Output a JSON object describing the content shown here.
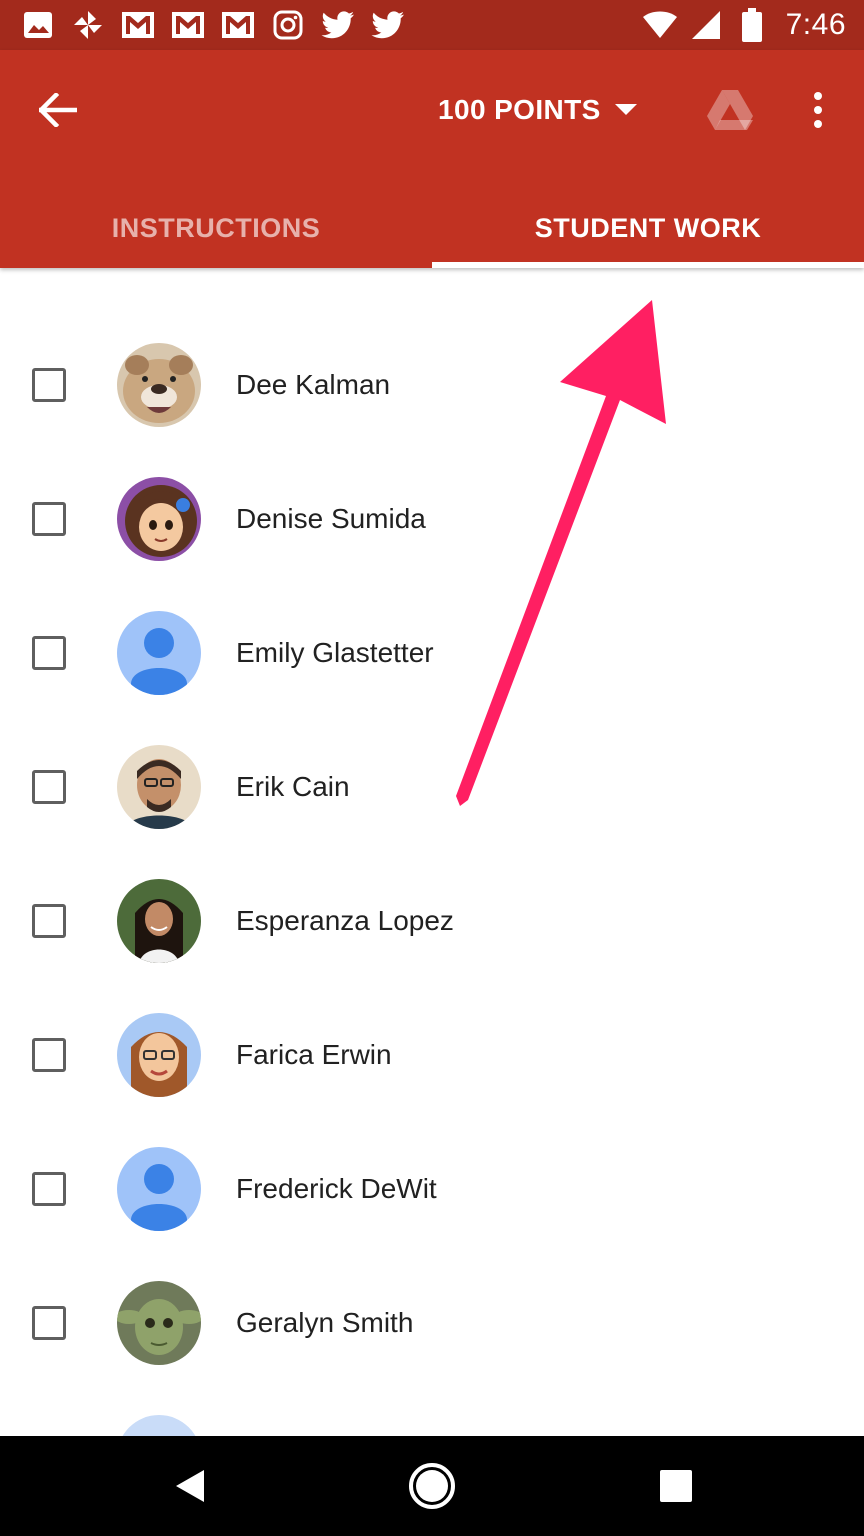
{
  "status_bar": {
    "time": "7:46",
    "left_icons": [
      "image-icon",
      "pinwheel-icon",
      "gmail-icon",
      "gmail-icon",
      "gmail-icon",
      "instagram-icon",
      "twitter-icon",
      "twitter-icon"
    ],
    "right_icons": [
      "wifi-icon",
      "signal-icon",
      "battery-icon"
    ]
  },
  "app_bar": {
    "points_label": "100 POINTS",
    "tabs": [
      {
        "label": "INSTRUCTIONS",
        "selected": false
      },
      {
        "label": "STUDENT WORK",
        "selected": true
      }
    ],
    "colors": {
      "status_bar": "#A32A1C",
      "app_bar": "#C13222"
    }
  },
  "students": [
    {
      "name": "Dee Kalman",
      "avatar": "bulldog-photo",
      "checked": false
    },
    {
      "name": "Denise Sumida",
      "avatar": "cartoon-girl",
      "checked": false
    },
    {
      "name": "Emily Glastetter",
      "avatar": "default-person-icon",
      "checked": false
    },
    {
      "name": "Erik Cain",
      "avatar": "man-photo",
      "checked": false
    },
    {
      "name": "Esperanza Lopez",
      "avatar": "woman-photo",
      "checked": false
    },
    {
      "name": "Farica Erwin",
      "avatar": "bitmoji-woman",
      "checked": false
    },
    {
      "name": "Frederick DeWit",
      "avatar": "default-person-icon",
      "checked": false
    },
    {
      "name": "Geralyn Smith",
      "avatar": "yoda-photo",
      "checked": false
    }
  ],
  "annotation": {
    "arrow_color": "#FF1F62"
  },
  "nav_bar": {
    "buttons": [
      "back-triangle-icon",
      "home-circle-icon",
      "recents-square-icon"
    ]
  }
}
